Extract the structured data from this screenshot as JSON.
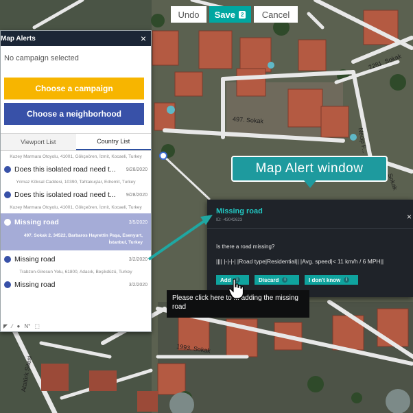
{
  "toolbar": {
    "undo_label": "Undo",
    "save_label": "Save",
    "save_badge": "2",
    "cancel_label": "Cancel"
  },
  "panel": {
    "title": "Map Alerts",
    "campaign_status": "No campaign selected",
    "choose_campaign_label": "Choose a campaign",
    "choose_neighborhood_label": "Choose a neighborhood",
    "tabs": [
      {
        "label": "Viewport List",
        "active": false
      },
      {
        "label": "Country List",
        "active": true
      }
    ],
    "list": [
      {
        "type": "address",
        "text": "Kuzey Marmara Otoyolu, 41001, Gökçeören, İzmit, Kocaeli, Turkey"
      },
      {
        "type": "item",
        "title": "Does this isolated road need t...",
        "date": "9/28/2020"
      },
      {
        "type": "address",
        "text": "Yılmaz Köksal Caddesi, 10390, Tahtakuşlar, Edremit, Turkey"
      },
      {
        "type": "item",
        "title": "Does this isolated road need t...",
        "date": "9/28/2020"
      },
      {
        "type": "address",
        "text": "Kuzey Marmara Otoyolu, 41001, Gökçeören, İzmit, Kocaeli, Turkey"
      },
      {
        "type": "selected",
        "title": "Missing road",
        "date": "3/5/2020",
        "address": "497. Sokak 2, 34522, Barbaros Hayrettin Paşa, Esenyurt, İstanbul, Turkey"
      },
      {
        "type": "item",
        "title": "Missing road",
        "date": "3/2/2020"
      },
      {
        "type": "address",
        "text": "Trabzon-Giresun Yolu, 61800, Adacık, Beşikdüzü, Turkey"
      },
      {
        "type": "item",
        "title": "Missing road",
        "date": "3/2/2020"
      }
    ],
    "footer_icons": [
      "cursor-icon",
      "ruler-icon",
      "pin-icon",
      "north-icon",
      "fullscreen-icon"
    ],
    "footer_north": "N°"
  },
  "callout": {
    "text": "Map Alert window"
  },
  "alert_window": {
    "title": "Missing road",
    "id": "ID: -43042623",
    "question": "Is there a road missing?",
    "road_line": "|||| |-|-|-| |Road type|Residential|| |Avg. speed|< 11 km/h / 6 MPH||",
    "buttons": [
      {
        "label": "Add"
      },
      {
        "label": "Discard"
      },
      {
        "label": "I don't know"
      }
    ]
  },
  "tooltip": {
    "text": "Please click here to ... adding the missing road"
  },
  "map": {
    "road_labels": [
      "497. Sokak",
      "2281. Sokak",
      "Necip F...",
      "1993. Sokak",
      "Atatürk Sitesi",
      "Sokak"
    ]
  },
  "colors": {
    "accent_teal": "#00a7a1",
    "campaign_yellow": "#f7b500",
    "neighborhood_blue": "#3851a8",
    "panel_header": "#1b2636",
    "alert_bg": "#1f2329"
  }
}
